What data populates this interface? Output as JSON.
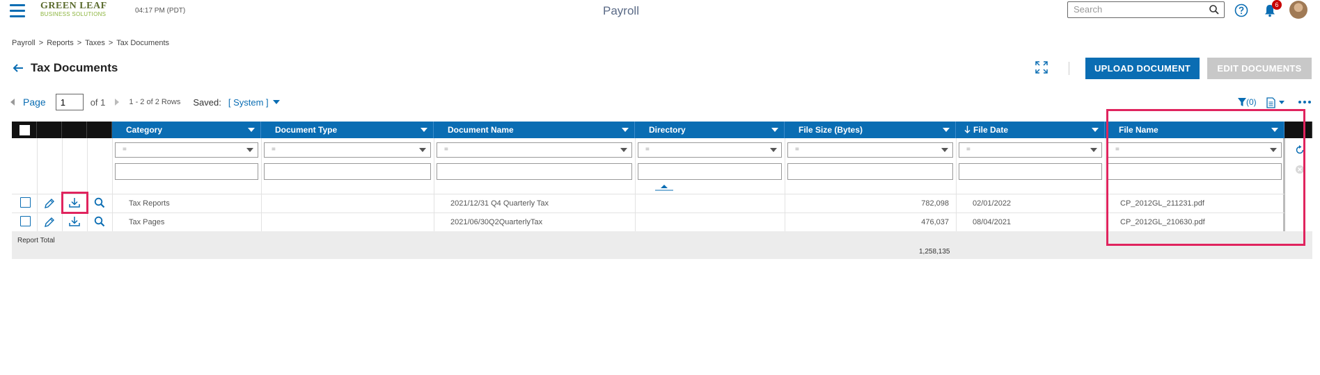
{
  "header": {
    "logo_line1": "GREEN LEAF",
    "logo_line2": "BUSINESS SOLUTIONS",
    "time": "04:17 PM (PDT)",
    "app_title": "Payroll",
    "search_placeholder": "Search",
    "notification_count": "6"
  },
  "breadcrumb": [
    "Payroll",
    ">",
    "Reports",
    ">",
    "Taxes",
    ">",
    "Tax Documents"
  ],
  "page": {
    "title": "Tax Documents",
    "upload_label": "UPLOAD DOCUMENT",
    "edit_label": "EDIT DOCUMENTS"
  },
  "pager": {
    "page_label": "Page",
    "page_value": "1",
    "of_label": "of 1",
    "rows_label": "1 - 2 of 2 Rows",
    "saved_label": "Saved:",
    "saved_value": "[ System ]",
    "filter_count": "(0)"
  },
  "columns": {
    "category": "Category",
    "document_type": "Document Type",
    "document_name": "Document Name",
    "directory": "Directory",
    "file_size": "File Size (Bytes)",
    "file_date": "File Date",
    "file_name": "File Name"
  },
  "filter_operator": "=",
  "rows": [
    {
      "category": "Tax Reports",
      "document_type": "",
      "document_name": "2021/12/31 Q4 Quarterly Tax",
      "directory": "",
      "file_size": "782,098",
      "file_date": "02/01/2022",
      "file_name": "CP_2012GL_211231.pdf"
    },
    {
      "category": "Tax Pages",
      "document_type": "",
      "document_name": "2021/06/30Q2QuarterlyTax",
      "directory": "",
      "file_size": "476,037",
      "file_date": "08/04/2021",
      "file_name": "CP_2012GL_210630.pdf"
    }
  ],
  "totals": {
    "label": "Report Total",
    "file_size_total": "1,258,135"
  },
  "colors": {
    "primary": "#0a6db3",
    "highlight": "#e0245e",
    "disabled": "#c8c8c8",
    "badge": "#c80000"
  }
}
